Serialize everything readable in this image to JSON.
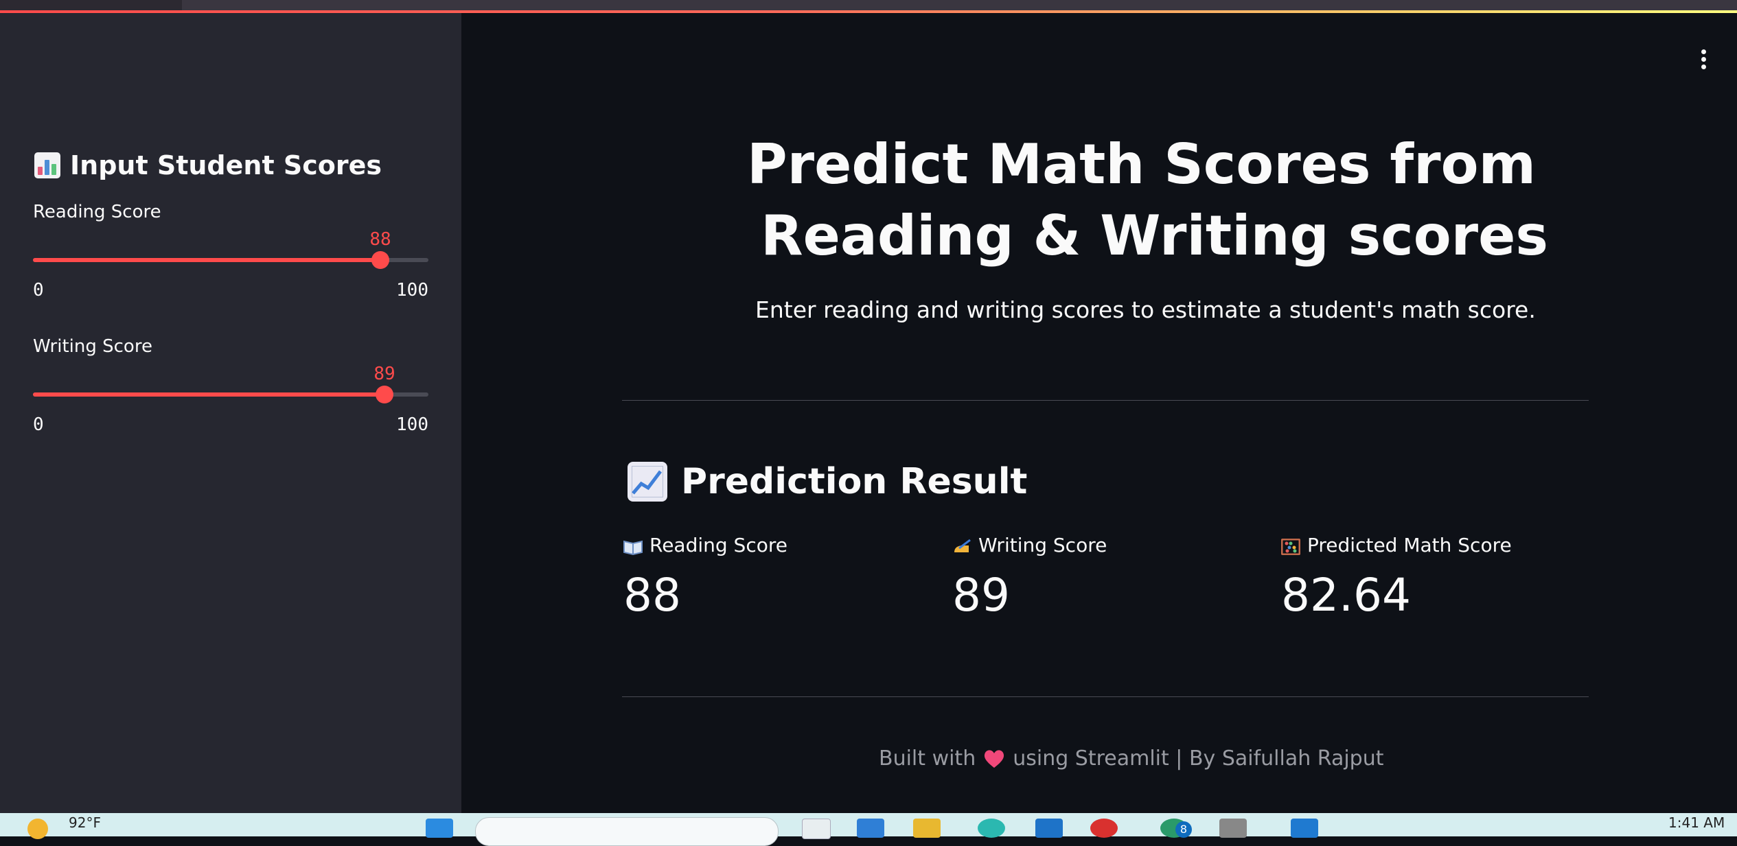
{
  "sidebar": {
    "title": "Input Student Scores",
    "sliders": [
      {
        "label": "Reading Score",
        "value": "88",
        "min": "0",
        "max": "100"
      },
      {
        "label": "Writing Score",
        "value": "89",
        "min": "0",
        "max": "100"
      }
    ]
  },
  "main": {
    "title_line1": "Predict Math Scores from",
    "title_line2": "Reading & Writing scores",
    "subtitle": "Enter reading and writing scores to estimate a student's math score.",
    "result_header": "Prediction Result",
    "metrics": [
      {
        "label": "Reading Score",
        "value": "88",
        "icon": "book-icon"
      },
      {
        "label": "Writing Score",
        "value": "89",
        "icon": "writing-hand-icon"
      },
      {
        "label": "Predicted Math Score",
        "value": "82.64",
        "icon": "abacus-icon"
      }
    ],
    "footer_prefix": "Built with",
    "footer_suffix": "using Streamlit | By Saifullah Rajput"
  },
  "taskbar": {
    "temperature": "92°F",
    "time": "1:41 AM",
    "notification_count": "8"
  },
  "colors": {
    "accent": "#ff4b4b",
    "background": "#0e1117",
    "sidebar": "#262730"
  }
}
